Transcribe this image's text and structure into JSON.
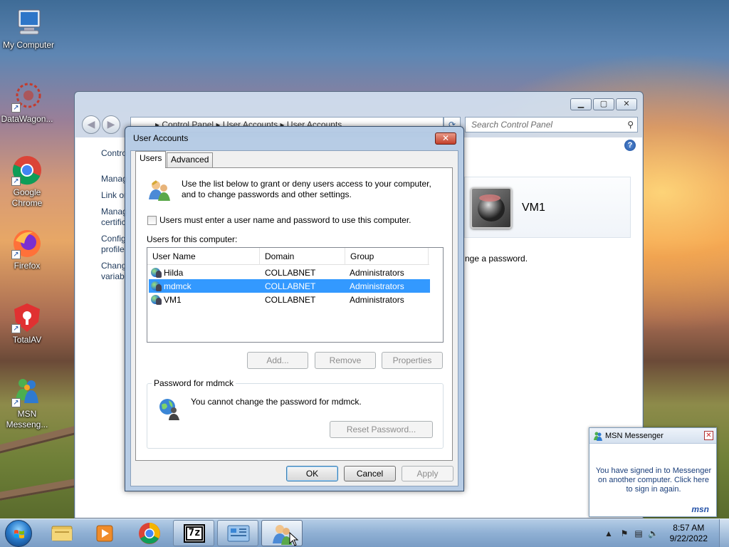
{
  "desktop": {
    "icons": [
      {
        "label": "My Computer",
        "icon": "computer-icon"
      },
      {
        "label": "DataWagon...",
        "icon": "datawagon-icon"
      },
      {
        "label": "Google Chrome",
        "icon": "chrome-icon"
      },
      {
        "label": "Firefox",
        "icon": "firefox-icon"
      },
      {
        "label": "TotalAV",
        "icon": "totalav-icon"
      },
      {
        "label": "MSN Messeng...",
        "icon": "msn-messenger-icon"
      }
    ]
  },
  "control_panel": {
    "address": {
      "segments": [
        "Control Panel",
        "User Accounts",
        "User Accounts"
      ],
      "separator": "▸"
    },
    "search_placeholder": "Search Control Panel",
    "sidebar": [
      "Contro",
      "Manag",
      "Link or",
      "Manag certific",
      "Config profile",
      "Chang variabl"
    ],
    "account_name": "VM1",
    "change_text": "nge a password."
  },
  "dialog": {
    "title": "User Accounts",
    "tabs": [
      {
        "label": "Users",
        "active": true
      },
      {
        "label": "Advanced",
        "active": false
      }
    ],
    "intro": "Use the list below to grant or deny users access to your computer, and to change passwords and other settings.",
    "require_password_label": "Users must enter a user name and password to use this computer.",
    "require_password_checked": false,
    "users_label": "Users for this computer:",
    "columns": [
      "User Name",
      "Domain",
      "Group"
    ],
    "users": [
      {
        "name": "Hilda",
        "domain": "COLLABNET",
        "group": "Administrators",
        "selected": false
      },
      {
        "name": "mdmck",
        "domain": "COLLABNET",
        "group": "Administrators",
        "selected": true
      },
      {
        "name": "VM1",
        "domain": "COLLABNET",
        "group": "Administrators",
        "selected": false
      }
    ],
    "buttons": {
      "add": "Add...",
      "remove": "Remove",
      "properties": "Properties"
    },
    "password_group": {
      "legend": "Password for mdmck",
      "message": "You cannot change the password for mdmck.",
      "reset_button": "Reset Password..."
    },
    "footer": {
      "ok": "OK",
      "cancel": "Cancel",
      "apply": "Apply"
    }
  },
  "msn_toast": {
    "title": "MSN Messenger",
    "message": "You have signed in to Messenger on another computer. Click here to sign in again.",
    "logo": "msn"
  },
  "taskbar": {
    "pinned": [
      "explorer-icon",
      "media-player-icon",
      "chrome-icon",
      "7zip-icon",
      "control-panel-icon",
      "user-accounts-icon"
    ],
    "seven_zip_label": "7z",
    "clock_time": "8:57 AM",
    "clock_date": "9/22/2022"
  },
  "colors": {
    "selection": "#3399ff",
    "link": "#1e395b",
    "close_red": "#c3402b"
  }
}
